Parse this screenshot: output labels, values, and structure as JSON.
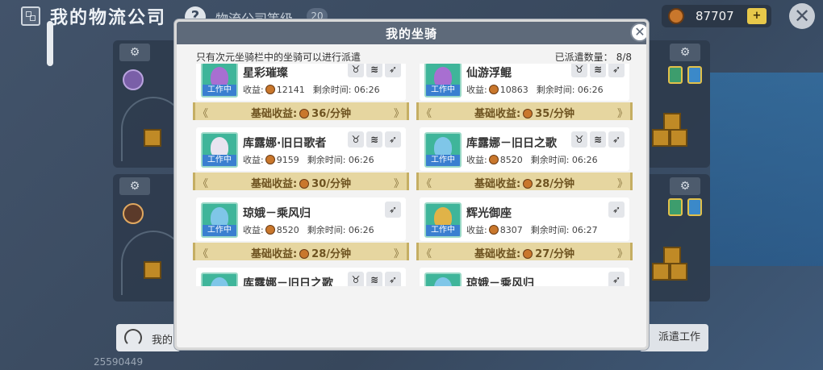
{
  "header": {
    "title": "我的物流公司",
    "level_label": "物流公司等级",
    "level_value": "20",
    "coins": "87707"
  },
  "bottom": {
    "tab_label": "我的",
    "dispatch_button": "派遣工作",
    "user_id": "25590449"
  },
  "modal": {
    "title": "我的坐骑",
    "notice": "只有次元坐骑栏中的坐骑可以进行派遣",
    "dispatch_count_label": "已派遣数量：",
    "dispatch_count_value": "8/8",
    "income_label": "收益:",
    "remain_label": "剩余时间:",
    "base_income_label": "基础收益:",
    "working_tag": "工作中"
  },
  "mounts": {
    "left": [
      {
        "name": "星彩璀璨",
        "income": "12141",
        "remaining": "06:26",
        "base_income": "36/分钟",
        "working": true,
        "skills": [
          "ox",
          "wave",
          "wing"
        ]
      },
      {
        "name": "库露娜·旧日歌者",
        "income": "9159",
        "remaining": "06:26",
        "base_income": "30/分钟",
        "working": true,
        "skills": [
          "ox",
          "wave",
          "wing"
        ]
      },
      {
        "name": "琼娥－乘风归",
        "income": "8520",
        "remaining": "06:26",
        "base_income": "28/分钟",
        "working": true,
        "skills": [
          "wing"
        ]
      },
      {
        "name": "库露娜－旧日之歌",
        "income": "",
        "remaining": "",
        "base_income": "",
        "working": false,
        "skills": [
          "ox",
          "wave",
          "wing"
        ]
      }
    ],
    "right": [
      {
        "name": "仙游浮鲲",
        "income": "10863",
        "remaining": "06:26",
        "base_income": "35/分钟",
        "working": true,
        "skills": [
          "ox",
          "wave",
          "wing"
        ]
      },
      {
        "name": "库露娜－旧日之歌",
        "income": "8520",
        "remaining": "06:26",
        "base_income": "28/分钟",
        "working": true,
        "skills": [
          "ox",
          "wave",
          "wing"
        ]
      },
      {
        "name": "辉光御座",
        "income": "8307",
        "remaining": "06:27",
        "base_income": "27/分钟",
        "working": true,
        "skills": [
          "wing"
        ]
      },
      {
        "name": "琼娥－乘风归",
        "income": "",
        "remaining": "",
        "base_income": "",
        "working": false,
        "skills": [
          "wing"
        ]
      }
    ]
  },
  "icons": {
    "home": "grid-home-icon",
    "help": "question-icon",
    "coin": "coin-icon",
    "shop": "cart-icon",
    "close": "close-icon",
    "gear": "gear-icon",
    "skill_ox": "ox-horn-icon",
    "skill_wave": "wave-icon",
    "skill_wing": "wing-icon"
  },
  "colors": {
    "header": "#5e6a7a",
    "working_tag": "#3a7fd0",
    "base_bar": "#e6d6a0",
    "coin": "#c9772c"
  }
}
